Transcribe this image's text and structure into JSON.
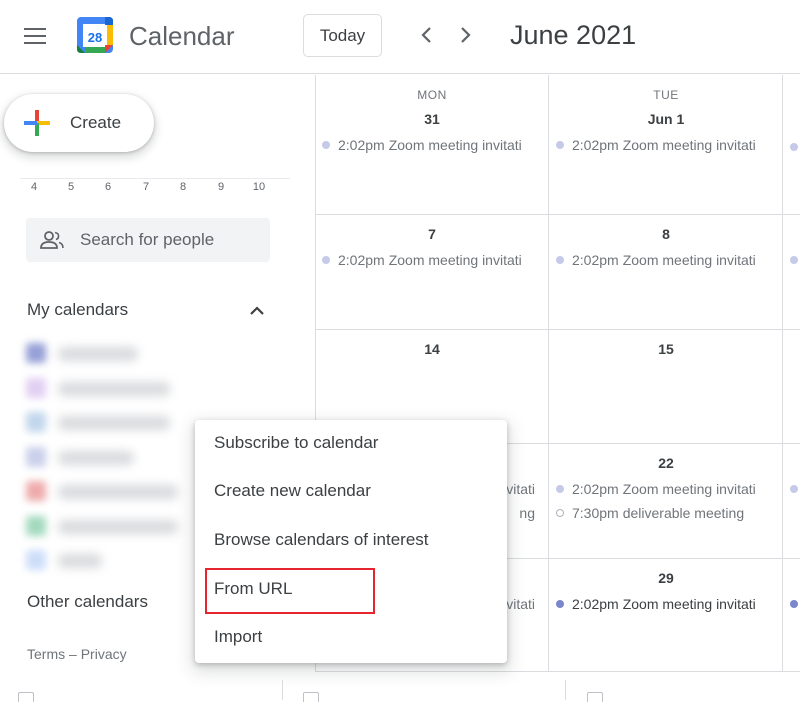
{
  "header": {
    "app_title": "Calendar",
    "logo_day": "28",
    "today_label": "Today",
    "prev_icon": "chevron-left-icon",
    "next_icon": "chevron-right-icon",
    "month_title": "June 2021"
  },
  "sidebar": {
    "create_label": "Create",
    "mini_calendar_days": [
      "4",
      "5",
      "6",
      "7",
      "8",
      "9",
      "10"
    ],
    "search_people_placeholder": "Search for people",
    "my_calendars_label": "My calendars",
    "my_calendar_colors": [
      "#3f51b5",
      "#c9a8e8",
      "#8fb4dc",
      "#9fa8da",
      "#e06666",
      "#57bb8a",
      "#a4c2f4"
    ],
    "other_calendars_label": "Other calendars",
    "footer": {
      "terms": "Terms",
      "separator": "–",
      "privacy": "Privacy"
    }
  },
  "grid": {
    "day_headers": [
      "MON",
      "TUE"
    ],
    "weeks": [
      {
        "dates": [
          "31",
          "Jun 1"
        ],
        "events": [
          [
            {
              "time": "2:02pm",
              "title": "Zoom meeting invitati",
              "style": "dim"
            }
          ],
          [
            {
              "time": "2:02pm",
              "title": "Zoom meeting invitati",
              "style": "dim"
            }
          ]
        ]
      },
      {
        "dates": [
          "7",
          "8"
        ],
        "events": [
          [
            {
              "time": "2:02pm",
              "title": "Zoom meeting invitati",
              "style": "dim"
            }
          ],
          [
            {
              "time": "2:02pm",
              "title": "Zoom meeting invitati",
              "style": "dim"
            }
          ]
        ]
      },
      {
        "dates": [
          "14",
          "15"
        ],
        "events": [
          [],
          []
        ]
      },
      {
        "dates": [
          "",
          "22"
        ],
        "events": [
          [
            {
              "time": "",
              "title": "vitati",
              "style": "dim"
            },
            {
              "time": "",
              "title": "ng",
              "style": "plain"
            }
          ],
          [
            {
              "time": "2:02pm",
              "title": "Zoom meeting invitati",
              "style": "dim"
            },
            {
              "time": "7:30pm",
              "title": "deliverable meeting",
              "style": "outline"
            }
          ]
        ]
      },
      {
        "dates": [
          "",
          "29"
        ],
        "events": [
          [
            {
              "time": "",
              "title": "vitati",
              "style": "dim"
            }
          ],
          [
            {
              "time": "2:02pm",
              "title": "Zoom meeting invitati",
              "style": "strong"
            }
          ]
        ]
      }
    ]
  },
  "context_menu": {
    "items": [
      "Subscribe to calendar",
      "Create new calendar",
      "Browse calendars of interest",
      "From URL",
      "Import"
    ],
    "highlighted": "From URL"
  }
}
